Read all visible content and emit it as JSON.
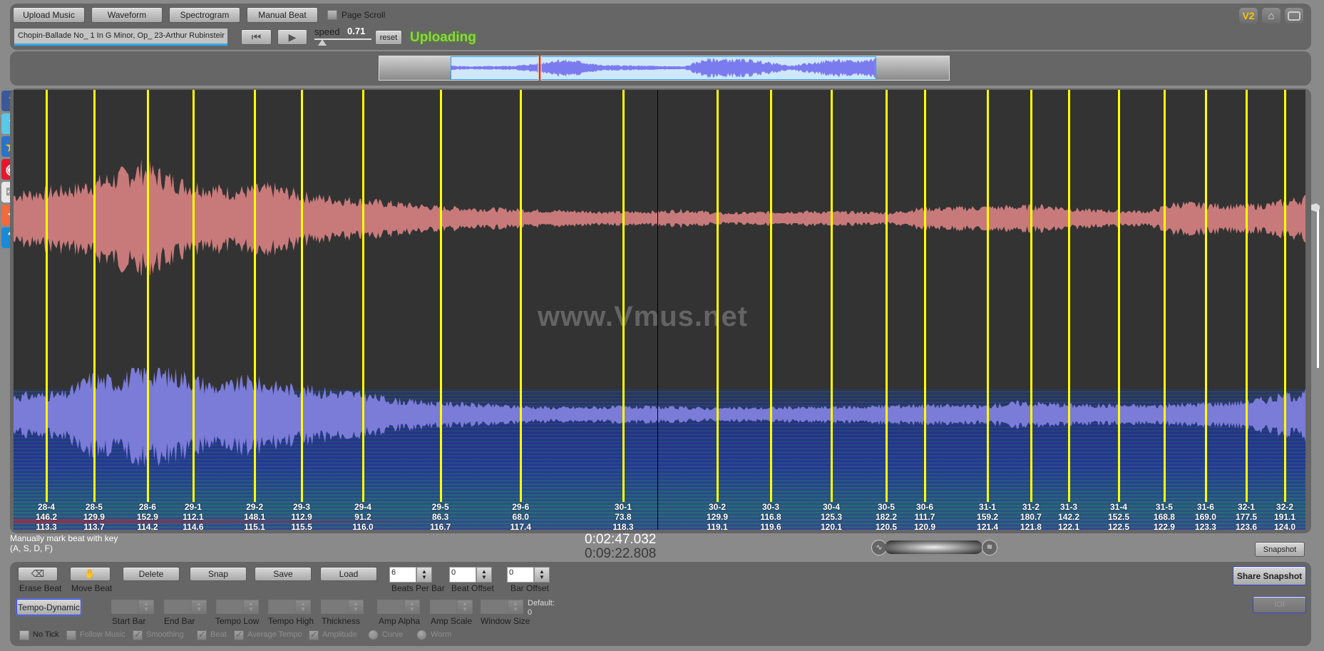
{
  "toolbar": {
    "upload_label": "Upload Music",
    "waveform_label": "Waveform",
    "spectrogram_label": "Spectrogram",
    "manual_beat_label": "Manual Beat",
    "page_scroll_label": "Page Scroll",
    "page_scroll_checked": false,
    "file_name": "Chopin-Ballade No_ 1 In G Minor, Op_ 23-Arthur Rubinsteir",
    "speed_label": "speed",
    "speed_value": "0.71",
    "reset_label": "reset",
    "status": "Uploading",
    "status_color": "#8ed44a",
    "version_badge": "V2"
  },
  "overview": {
    "selection_start_fraction": 0.125,
    "selection_end_fraction": 0.872,
    "playhead_fraction": 0.281
  },
  "social": [
    {
      "name": "facebook",
      "glyph": "f",
      "color": "#3b5998"
    },
    {
      "name": "twitter",
      "glyph": "t",
      "color": "#5ac8e8"
    },
    {
      "name": "qzone",
      "glyph": "★",
      "color": "#2a73c8"
    },
    {
      "name": "weibo",
      "glyph": "◉",
      "color": "#e6162d"
    },
    {
      "name": "email",
      "glyph": "✉",
      "color": "#e8e8e8"
    },
    {
      "name": "add",
      "glyph": "+",
      "color": "#f26a3d"
    },
    {
      "name": "help",
      "glyph": "?",
      "color": "#1a8ad6"
    }
  ],
  "main": {
    "watermark": "www.Vmus.net",
    "waveform_color": "#c87a7a",
    "lower_waveform_color": "#7b7bd8",
    "beat_color": "#ffff00",
    "playhead_fraction": 0.4985,
    "beats": [
      {
        "id": "28-4",
        "tempo": "146.2",
        "avg": "113.3",
        "x": 0.0254
      },
      {
        "id": "28-5",
        "tempo": "129.9",
        "avg": "113.7",
        "x": 0.0623
      },
      {
        "id": "28-6",
        "tempo": "152.9",
        "avg": "114.2",
        "x": 0.1037
      },
      {
        "id": "29-1",
        "tempo": "112.1",
        "avg": "114.6",
        "x": 0.139
      },
      {
        "id": "29-2",
        "tempo": "148.1",
        "avg": "115.1",
        "x": 0.1866
      },
      {
        "id": "29-3",
        "tempo": "112.9",
        "avg": "115.5",
        "x": 0.223
      },
      {
        "id": "29-4",
        "tempo": "91.2",
        "avg": "116.0",
        "x": 0.2704
      },
      {
        "id": "29-5",
        "tempo": "86.3",
        "avg": "116.7",
        "x": 0.3304
      },
      {
        "id": "29-6",
        "tempo": "68.0",
        "avg": "117.4",
        "x": 0.3925
      },
      {
        "id": "30-1",
        "tempo": "73.8",
        "avg": "118.3",
        "x": 0.4718
      },
      {
        "id": "30-2",
        "tempo": "129.9",
        "avg": "119.1",
        "x": 0.5447
      },
      {
        "id": "30-3",
        "tempo": "116.8",
        "avg": "119.6",
        "x": 0.5861
      },
      {
        "id": "30-4",
        "tempo": "125.3",
        "avg": "120.1",
        "x": 0.633
      },
      {
        "id": "30-5",
        "tempo": "182.2",
        "avg": "120.5",
        "x": 0.6755
      },
      {
        "id": "30-6",
        "tempo": "111.7",
        "avg": "120.9",
        "x": 0.7053
      },
      {
        "id": "31-1",
        "tempo": "159.2",
        "avg": "121.4",
        "x": 0.7539
      },
      {
        "id": "31-2",
        "tempo": "180.7",
        "avg": "121.8",
        "x": 0.7875
      },
      {
        "id": "31-3",
        "tempo": "142.2",
        "avg": "122.1",
        "x": 0.8168
      },
      {
        "id": "31-4",
        "tempo": "152.5",
        "avg": "122.5",
        "x": 0.8554
      },
      {
        "id": "31-5",
        "tempo": "168.8",
        "avg": "122.9",
        "x": 0.8907
      },
      {
        "id": "31-6",
        "tempo": "169.0",
        "avg": "123.3",
        "x": 0.9227
      },
      {
        "id": "32-1",
        "tempo": "177.5",
        "avg": "123.6",
        "x": 0.9542
      },
      {
        "id": "32-2",
        "tempo": "191.1",
        "avg": "124.0",
        "x": 0.984
      }
    ]
  },
  "status_bar": {
    "hint_line1": "Manually mark beat with key",
    "hint_line2": "(A, S, D, F)",
    "current_time": "0:02:47.032",
    "total_time": "0:09:22.808",
    "snapshot_label": "Snapshot"
  },
  "controls": {
    "erase_beat_label": "Erase Beat",
    "move_beat_label": "Move Beat",
    "delete_label": "Delete",
    "snap_label": "Snap",
    "save_label": "Save",
    "load_label": "Load",
    "beats_per_bar_label": "Beats Per Bar",
    "beats_per_bar_value": "6",
    "beat_offset_label": "Beat Offset",
    "beat_offset_value": "0",
    "bar_offset_label": "Bar Offset",
    "bar_offset_value": "0",
    "tempo_dynamic_label": "Tempo-Dynamic",
    "start_bar_label": "Start Bar",
    "end_bar_label": "End Bar",
    "tempo_low_label": "Tempo Low",
    "tempo_high_label": "Tempo High",
    "thickness_label": "Thickness",
    "amp_alpha_label": "Amp Alpha",
    "amp_scale_label": "Amp Scale",
    "window_size_label": "Window Size",
    "default_label": "Default:",
    "default_value": "0",
    "share_snapshot_label": "Share Snapshot",
    "ioi_label": "IOI",
    "checkboxes": [
      {
        "label": "No Tick",
        "checked": false,
        "enabled": true
      },
      {
        "label": "Follow Music",
        "checked": false,
        "enabled": false
      },
      {
        "label": "Smoothing",
        "checked": true,
        "enabled": false
      },
      {
        "label": "Beat",
        "checked": true,
        "enabled": false
      },
      {
        "label": "Average Tempo",
        "checked": true,
        "enabled": false
      },
      {
        "label": "Amplitude",
        "checked": true,
        "enabled": false
      }
    ],
    "radios": [
      {
        "label": "Curve",
        "selected": true
      },
      {
        "label": "Worm",
        "selected": false
      }
    ]
  }
}
